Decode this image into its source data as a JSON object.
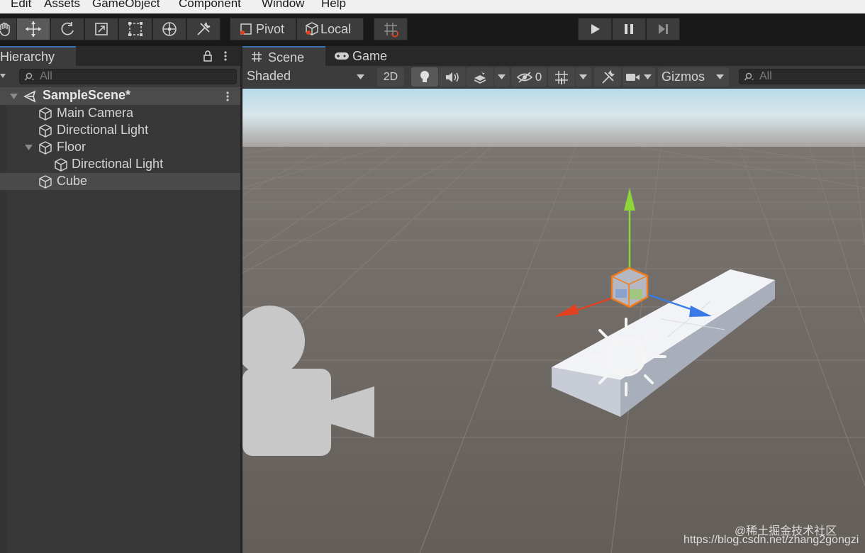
{
  "menu": [
    "Edit",
    "Assets",
    "GameObject",
    "Component",
    "Window",
    "Help"
  ],
  "toolbar": {
    "tools": [
      "hand-tool",
      "move-tool",
      "rotate-tool",
      "scale-tool",
      "rect-tool",
      "transform-tool",
      "custom-tool"
    ],
    "selected_tool": "move-tool",
    "pivot_label": "Pivot",
    "local_label": "Local"
  },
  "hierarchy": {
    "title": "Hierarchy",
    "search_placeholder": "All",
    "scene_name": "SampleScene*",
    "items": [
      {
        "label": "Main Camera",
        "depth": 1,
        "expanded": null,
        "selected": false
      },
      {
        "label": "Directional Light",
        "depth": 1,
        "expanded": null,
        "selected": false
      },
      {
        "label": "Floor",
        "depth": 1,
        "expanded": true,
        "selected": false
      },
      {
        "label": "Directional Light",
        "depth": 2,
        "expanded": null,
        "selected": false
      },
      {
        "label": "Cube",
        "depth": 1,
        "expanded": null,
        "selected": true
      }
    ]
  },
  "scene_view": {
    "tabs": [
      "Scene",
      "Game"
    ],
    "active_tab": "Scene",
    "shading_mode": "Shaded",
    "mode_2d_label": "2D",
    "hidden_count": "0",
    "gizmos_label": "Gizmos",
    "search_placeholder": "All"
  },
  "watermark": {
    "line1": "@稀土掘金技术社区",
    "line2": "https://blog.csdn.net/zhang2gongzi"
  },
  "colors": {
    "panel_bg": "#383838",
    "toolbar_bg": "#191919",
    "selected_row": "#4b4b4b",
    "x_axis": "#e2401f",
    "y_axis": "#8dd43a",
    "z_axis": "#3a7ae6",
    "selection_outline": "#f27b1c"
  }
}
